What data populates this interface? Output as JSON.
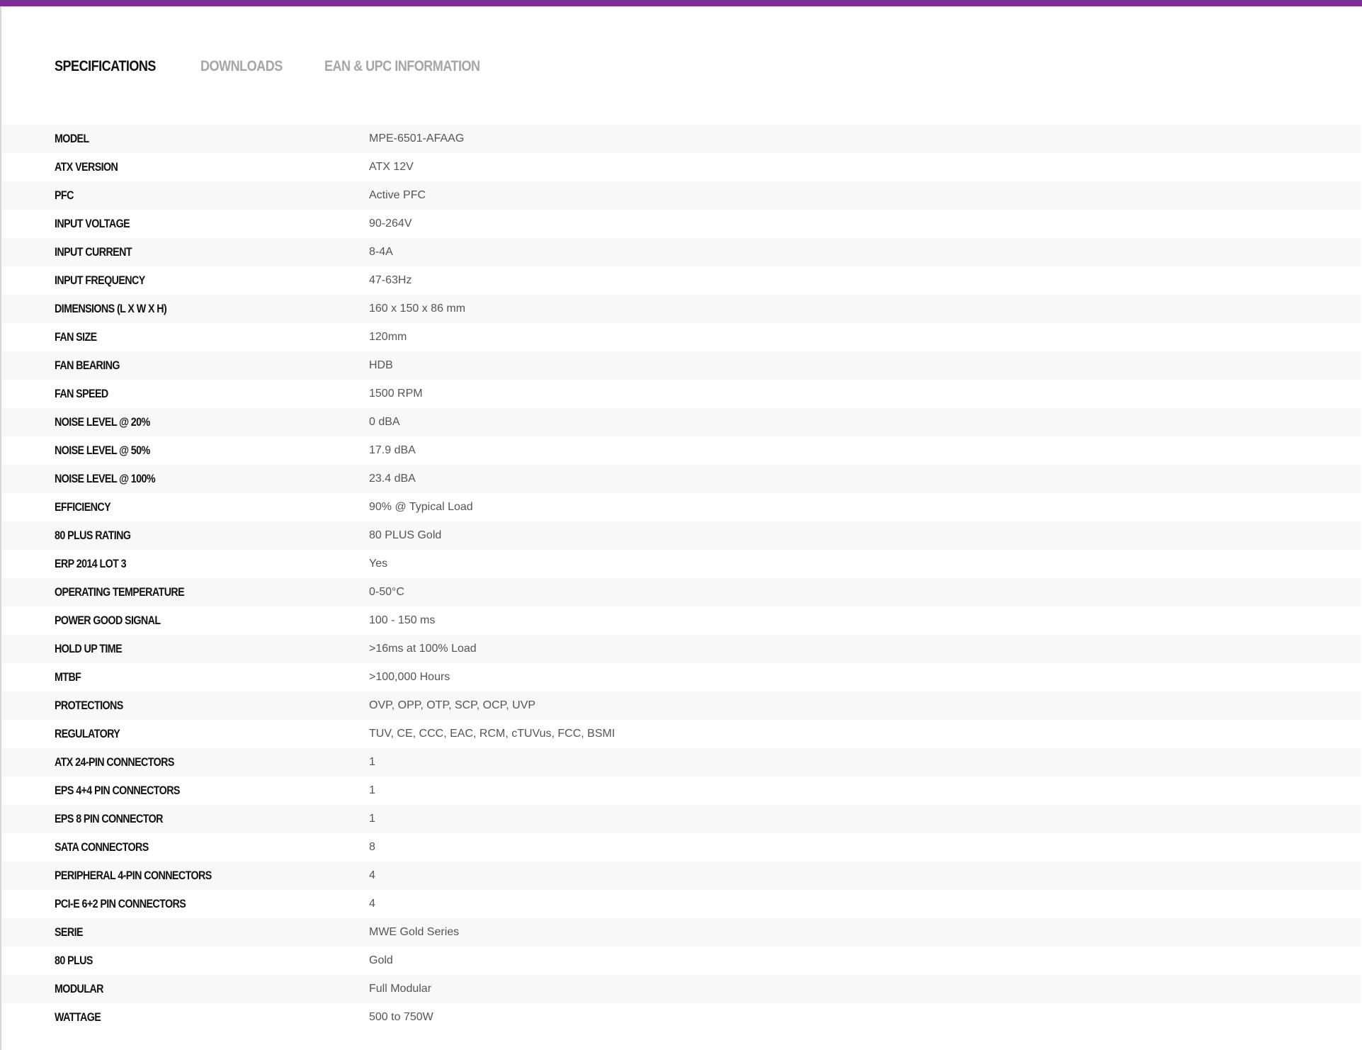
{
  "colors": {
    "accent": "#7b3193",
    "row_alt": "#f8f8f8",
    "label_text": "#111111",
    "value_text": "#555555",
    "tab_inactive": "#a6a6a6"
  },
  "tabs": [
    {
      "label": "SPECIFICATIONS",
      "active": true
    },
    {
      "label": "DOWNLOADS",
      "active": false
    },
    {
      "label": "EAN & UPC INFORMATION",
      "active": false
    }
  ],
  "specs": [
    {
      "label": "MODEL",
      "value": "MPE-6501-AFAAG"
    },
    {
      "label": "ATX VERSION",
      "value": "ATX 12V"
    },
    {
      "label": "PFC",
      "value": "Active PFC"
    },
    {
      "label": "INPUT VOLTAGE",
      "value": "90-264V"
    },
    {
      "label": "INPUT CURRENT",
      "value": "8-4A"
    },
    {
      "label": "INPUT FREQUENCY",
      "value": "47-63Hz"
    },
    {
      "label": "DIMENSIONS (L X W X H)",
      "value": "160 x 150 x 86 mm"
    },
    {
      "label": "FAN SIZE",
      "value": "120mm"
    },
    {
      "label": "FAN BEARING",
      "value": "HDB"
    },
    {
      "label": "FAN SPEED",
      "value": "1500 RPM"
    },
    {
      "label": "NOISE LEVEL @ 20%",
      "value": "0 dBA"
    },
    {
      "label": "NOISE LEVEL @ 50%",
      "value": "17.9 dBA"
    },
    {
      "label": "NOISE LEVEL @ 100%",
      "value": "23.4 dBA"
    },
    {
      "label": "EFFICIENCY",
      "value": "90% @ Typical Load"
    },
    {
      "label": "80 PLUS RATING",
      "value": "80 PLUS Gold"
    },
    {
      "label": "ERP 2014 LOT 3",
      "value": "Yes"
    },
    {
      "label": "OPERATING TEMPERATURE",
      "value": "0-50°C"
    },
    {
      "label": "POWER GOOD SIGNAL",
      "value": "100 - 150 ms"
    },
    {
      "label": "HOLD UP TIME",
      "value": ">16ms at 100% Load"
    },
    {
      "label": "MTBF",
      "value": ">100,000 Hours"
    },
    {
      "label": "PROTECTIONS",
      "value": "OVP, OPP, OTP, SCP, OCP, UVP"
    },
    {
      "label": "REGULATORY",
      "value": "TUV, CE, CCC, EAC, RCM, cTUVus, FCC, BSMI"
    },
    {
      "label": "ATX 24-PIN CONNECTORS",
      "value": "1"
    },
    {
      "label": "EPS 4+4 PIN CONNECTORS",
      "value": "1"
    },
    {
      "label": "EPS 8 PIN CONNECTOR",
      "value": "1"
    },
    {
      "label": "SATA CONNECTORS",
      "value": "8"
    },
    {
      "label": "PERIPHERAL 4-PIN CONNECTORS",
      "value": "4"
    },
    {
      "label": "PCI-E 6+2 PIN CONNECTORS",
      "value": "4"
    },
    {
      "label": "SERIE",
      "value": "MWE Gold Series"
    },
    {
      "label": "80 PLUS",
      "value": "Gold"
    },
    {
      "label": "MODULAR",
      "value": "Full Modular"
    },
    {
      "label": "WATTAGE",
      "value": "500 to 750W"
    }
  ]
}
